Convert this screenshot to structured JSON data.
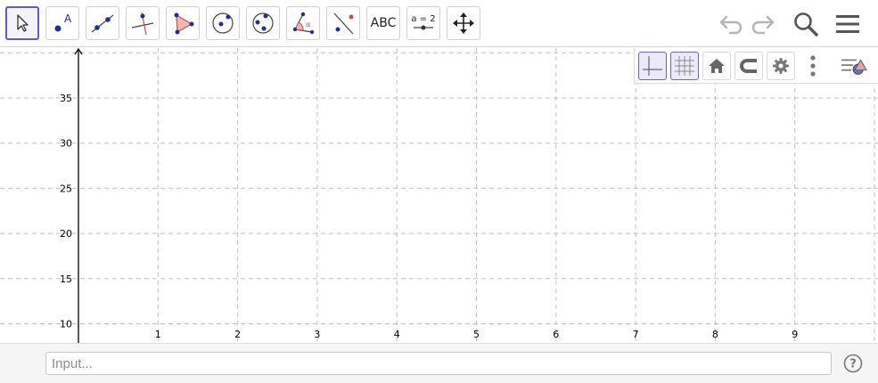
{
  "toolbar": {
    "tools": [
      {
        "id": "move",
        "icon": "arrow-pointer-icon",
        "selected": true
      },
      {
        "id": "point",
        "icon": "point-icon",
        "label": "A"
      },
      {
        "id": "line",
        "icon": "line-through-points-icon"
      },
      {
        "id": "perpendicular",
        "icon": "perpendicular-line-icon"
      },
      {
        "id": "polygon",
        "icon": "polygon-icon"
      },
      {
        "id": "circle-center",
        "icon": "circle-with-center-icon"
      },
      {
        "id": "circle-three-points",
        "icon": "circle-through-three-points-icon"
      },
      {
        "id": "angle",
        "icon": "angle-icon",
        "label": "α"
      },
      {
        "id": "reflect",
        "icon": "reflect-about-line-icon"
      },
      {
        "id": "text",
        "icon": "text-icon",
        "label": "ABC"
      },
      {
        "id": "slider",
        "icon": "slider-icon",
        "label": "a = 2"
      },
      {
        "id": "move-view",
        "icon": "move-graphics-view-icon"
      }
    ],
    "right_icons": [
      "undo-icon",
      "redo-icon",
      "search-icon",
      "menu-icon"
    ]
  },
  "style_bar": {
    "buttons": [
      "show-axes-icon",
      "show-grid-icon",
      "home-icon",
      "point-capturing-icon",
      "settings-gear-icon",
      "more-vertical-icon",
      "toggle-style-bar-icon"
    ]
  },
  "graph": {
    "x_ticks": [
      "1",
      "2",
      "3",
      "4",
      "5",
      "6",
      "7",
      "8",
      "9"
    ],
    "y_ticks": [
      "10",
      "15",
      "20",
      "25",
      "30",
      "35"
    ],
    "axis_color": "#000000",
    "grid_color": "#c0c0c0"
  },
  "input": {
    "placeholder": "Input..."
  },
  "colors": {
    "accent": "#6557d2",
    "point_blue": "#1f2f99",
    "polygon_fill": "#f2b5b5",
    "polygon_stroke": "#c0504d"
  }
}
